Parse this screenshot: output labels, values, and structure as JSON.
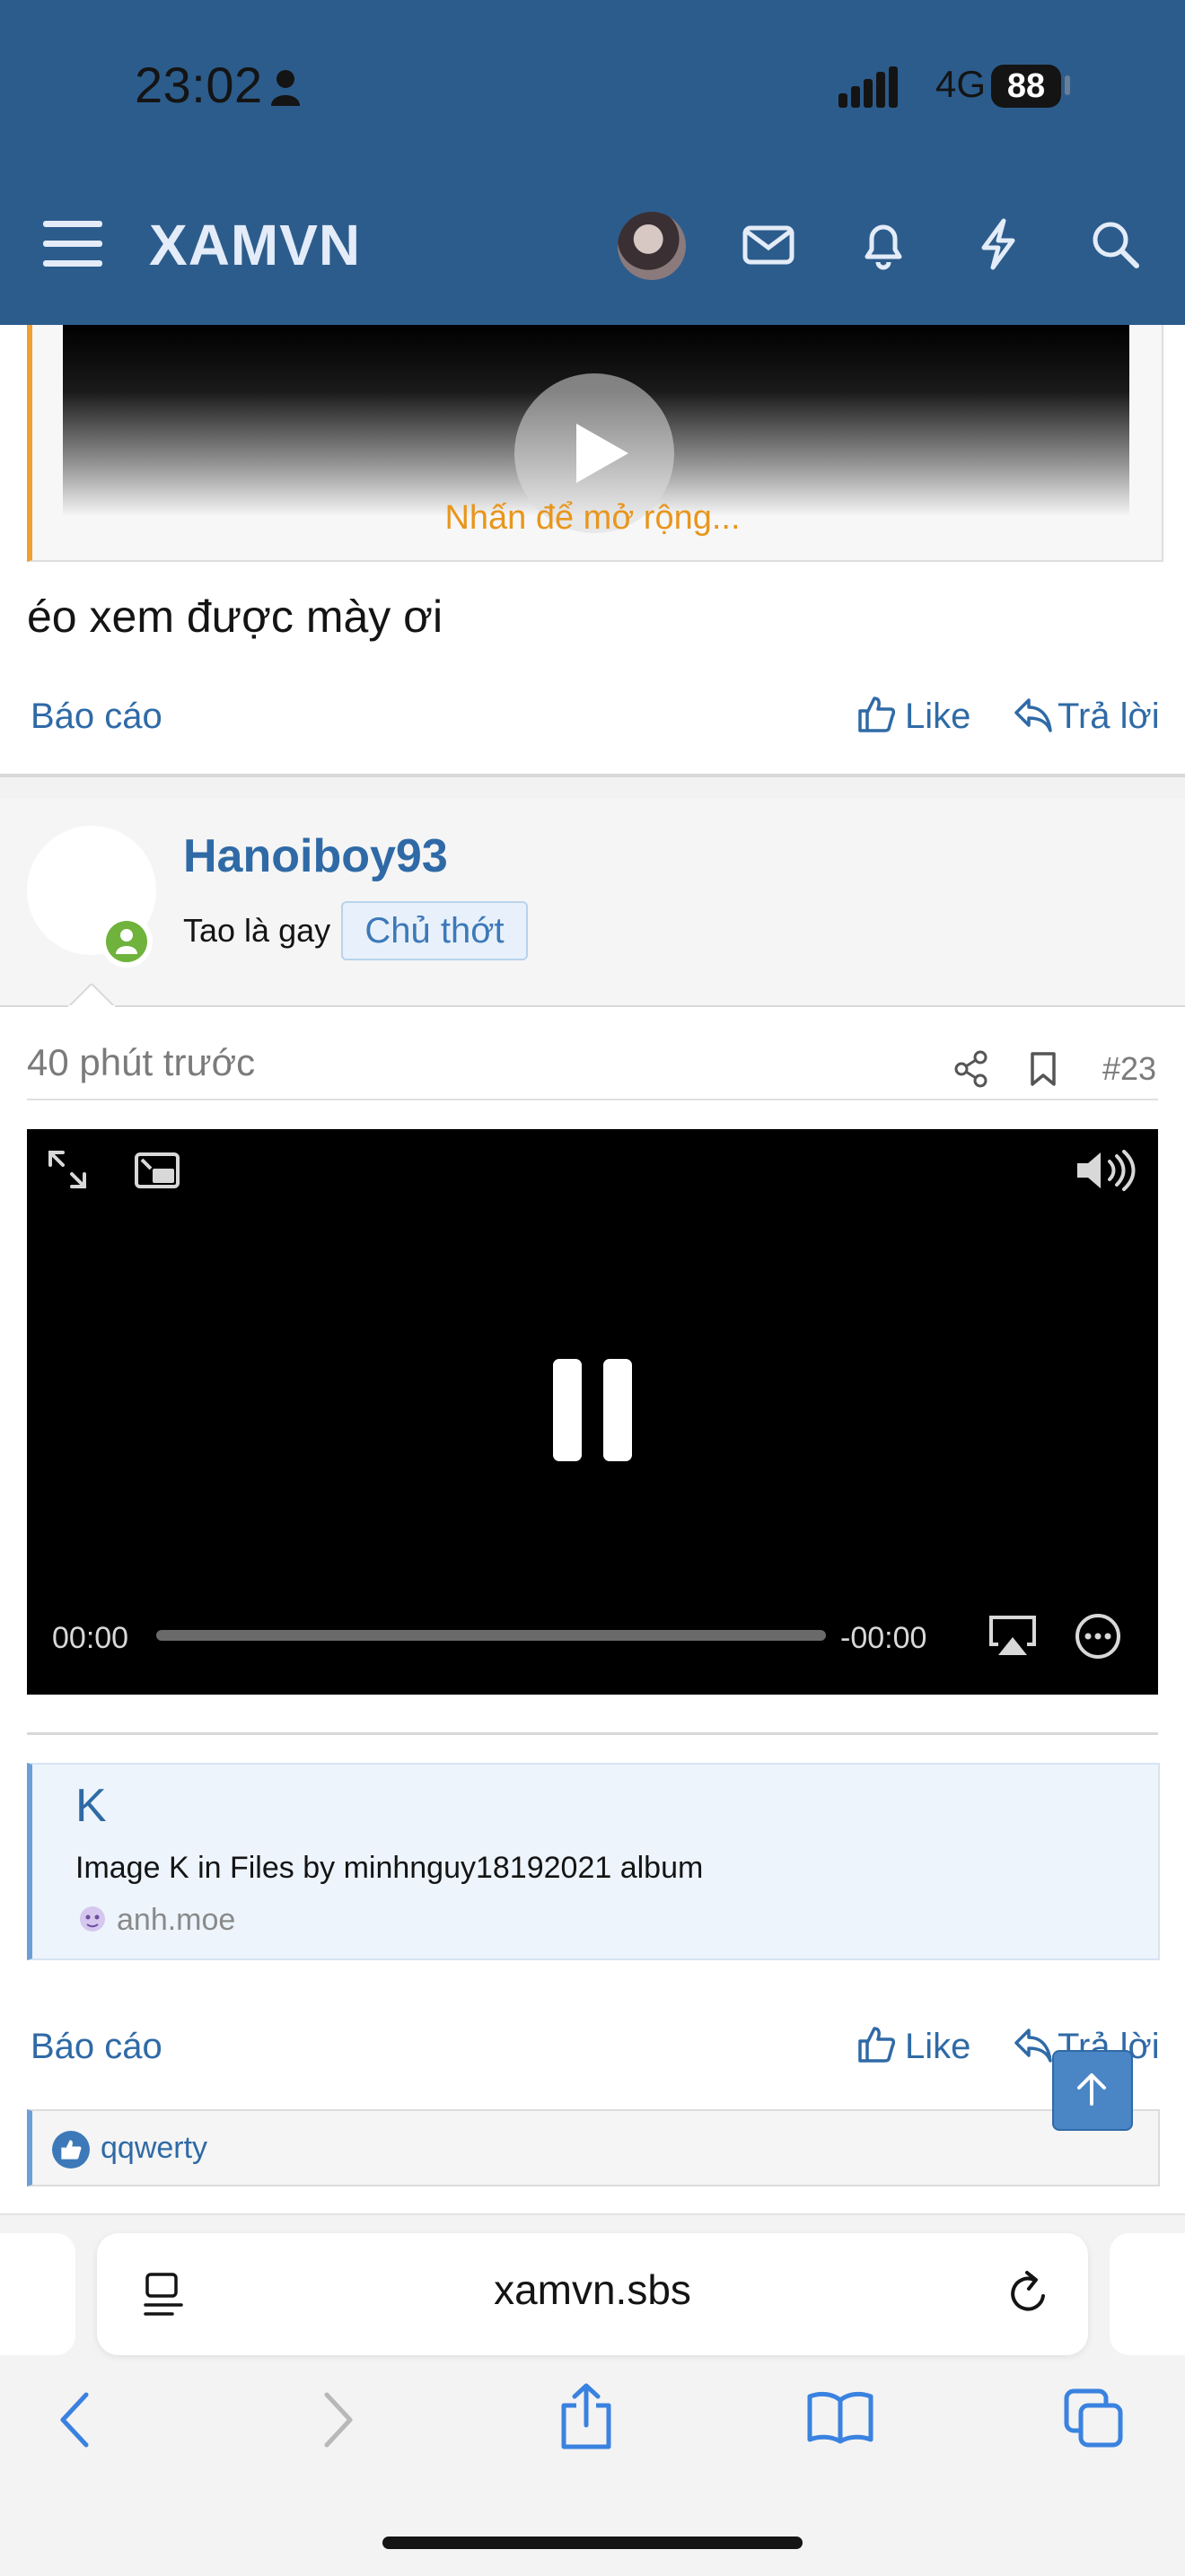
{
  "status_bar": {
    "time": "23:02",
    "network": "4G",
    "battery": "88"
  },
  "header": {
    "brand": "XAMVN"
  },
  "quoted": {
    "expand_text": "Nhấn để mở rộng..."
  },
  "post_prev": {
    "text": "éo xem được mày ơi",
    "report": "Báo cáo",
    "like": "Like",
    "reply": "Trả lời"
  },
  "post": {
    "username": "Hanoiboy93",
    "user_title": "Tao là gay",
    "badge": "Chủ thớt",
    "time_ago": "40 phút trước",
    "post_number": "#23",
    "video": {
      "current_time": "00:00",
      "remaining_time": "-00:00",
      "progress": 0
    },
    "embed": {
      "title": "K",
      "description": "Image K in Files by minhnguy18192021 album",
      "site": "anh.moe"
    },
    "report": "Báo cáo",
    "like": "Like",
    "reply": "Trả lời",
    "reactions": {
      "user": "qqwerty"
    }
  },
  "browser": {
    "url": "xamvn.sbs"
  },
  "colors": {
    "header": "#2c5c8c",
    "link": "#2f6aa6",
    "accent_orange": "#e8961e",
    "online": "#6fb23c"
  }
}
